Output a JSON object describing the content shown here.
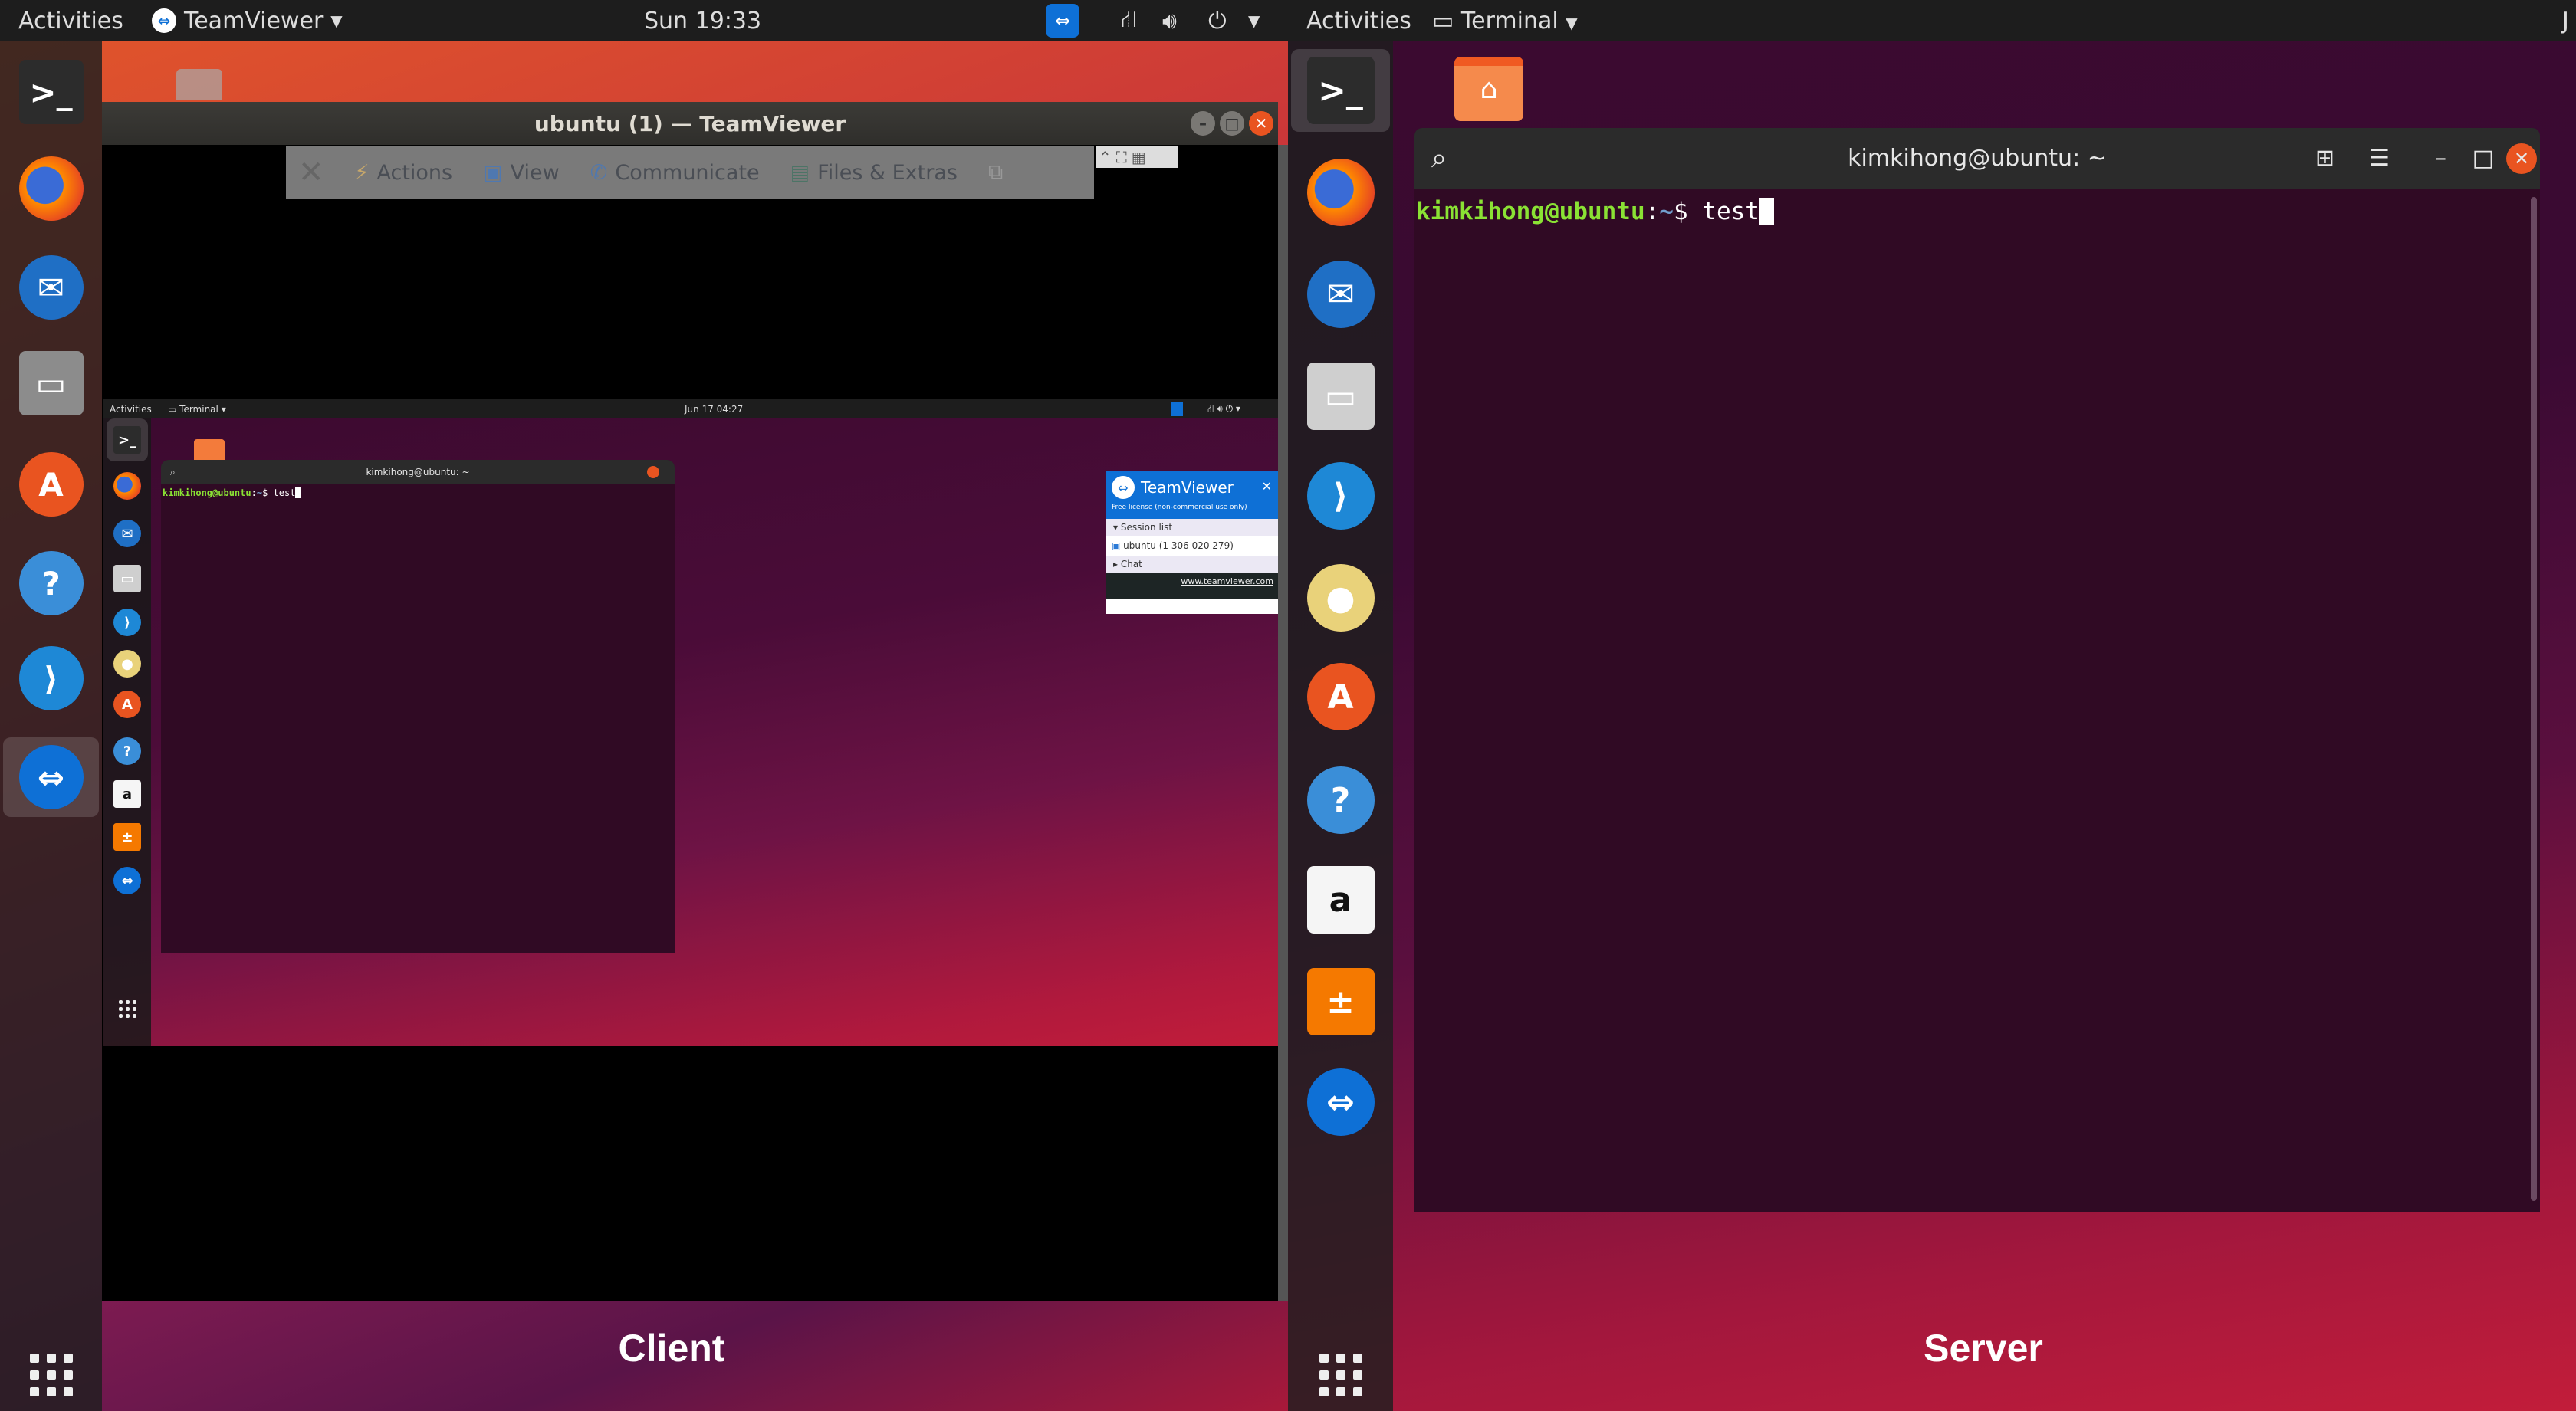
{
  "client": {
    "topbar": {
      "activities": "Activities",
      "app_menu": "TeamViewer",
      "clock": "Sun 19:33"
    },
    "dock": [
      {
        "name": "terminal",
        "glyph": ">_",
        "color": "#2c2c2c"
      },
      {
        "name": "firefox",
        "glyph": "",
        "color": "#e66000"
      },
      {
        "name": "thunderbird",
        "glyph": "✉",
        "color": "#1f6fc5"
      },
      {
        "name": "files",
        "glyph": "▭",
        "color": "#8c8c8c"
      },
      {
        "name": "software",
        "glyph": "A",
        "color": "#e95420"
      },
      {
        "name": "help",
        "glyph": "?",
        "color": "#3a8ed8"
      },
      {
        "name": "vscode",
        "glyph": "⟩",
        "color": "#1e88d6"
      },
      {
        "name": "teamviewer",
        "glyph": "⇔",
        "color": "#0e70d6"
      }
    ],
    "window": {
      "title": "ubuntu (1) — TeamViewer",
      "toolbar": {
        "actions": "Actions",
        "view": "View",
        "communicate": "Communicate",
        "files_extras": "Files & Extras"
      },
      "remote": {
        "topbar": {
          "activities": "Activities",
          "app_menu": "Terminal",
          "clock": "Jun 17 04:27"
        },
        "terminal": {
          "title": "kimkihong@ubuntu: ~",
          "user_host": "kimkihong@ubuntu",
          "path": "~",
          "prompt": "$",
          "command": "test"
        },
        "tv_panel": {
          "title": "TeamViewer",
          "license": "Free license (non-commercial use only)",
          "session_list": "Session list",
          "session": "ubuntu (1 306 020 279)",
          "chat": "Chat",
          "link": "www.teamviewer.com"
        }
      }
    },
    "label": "Client"
  },
  "server": {
    "topbar": {
      "activities": "Activities",
      "app_menu": "Terminal",
      "clock_partial": "J"
    },
    "dock": [
      {
        "name": "terminal",
        "glyph": ">_",
        "color": "#2c2c2c"
      },
      {
        "name": "firefox",
        "glyph": "",
        "color": "#e66000"
      },
      {
        "name": "thunderbird",
        "glyph": "✉",
        "color": "#1f6fc5"
      },
      {
        "name": "files",
        "glyph": "▭",
        "color": "#cfcfcf"
      },
      {
        "name": "vscode",
        "glyph": "⟩",
        "color": "#1e88d6"
      },
      {
        "name": "rhythmbox",
        "glyph": "●",
        "color": "#e9d27a"
      },
      {
        "name": "software",
        "glyph": "A",
        "color": "#e95420"
      },
      {
        "name": "help",
        "glyph": "?",
        "color": "#3a8ed8"
      },
      {
        "name": "amazon",
        "glyph": "a",
        "color": "#f5f5f5"
      },
      {
        "name": "calculator",
        "glyph": "±",
        "color": "#f57900"
      },
      {
        "name": "teamviewer",
        "glyph": "⇔",
        "color": "#0e70d6"
      }
    ],
    "terminal": {
      "title": "kimkihong@ubuntu: ~",
      "user_host": "kimkihong@ubuntu",
      "path": "~",
      "prompt": "$",
      "command": "test"
    },
    "label": "Server"
  }
}
